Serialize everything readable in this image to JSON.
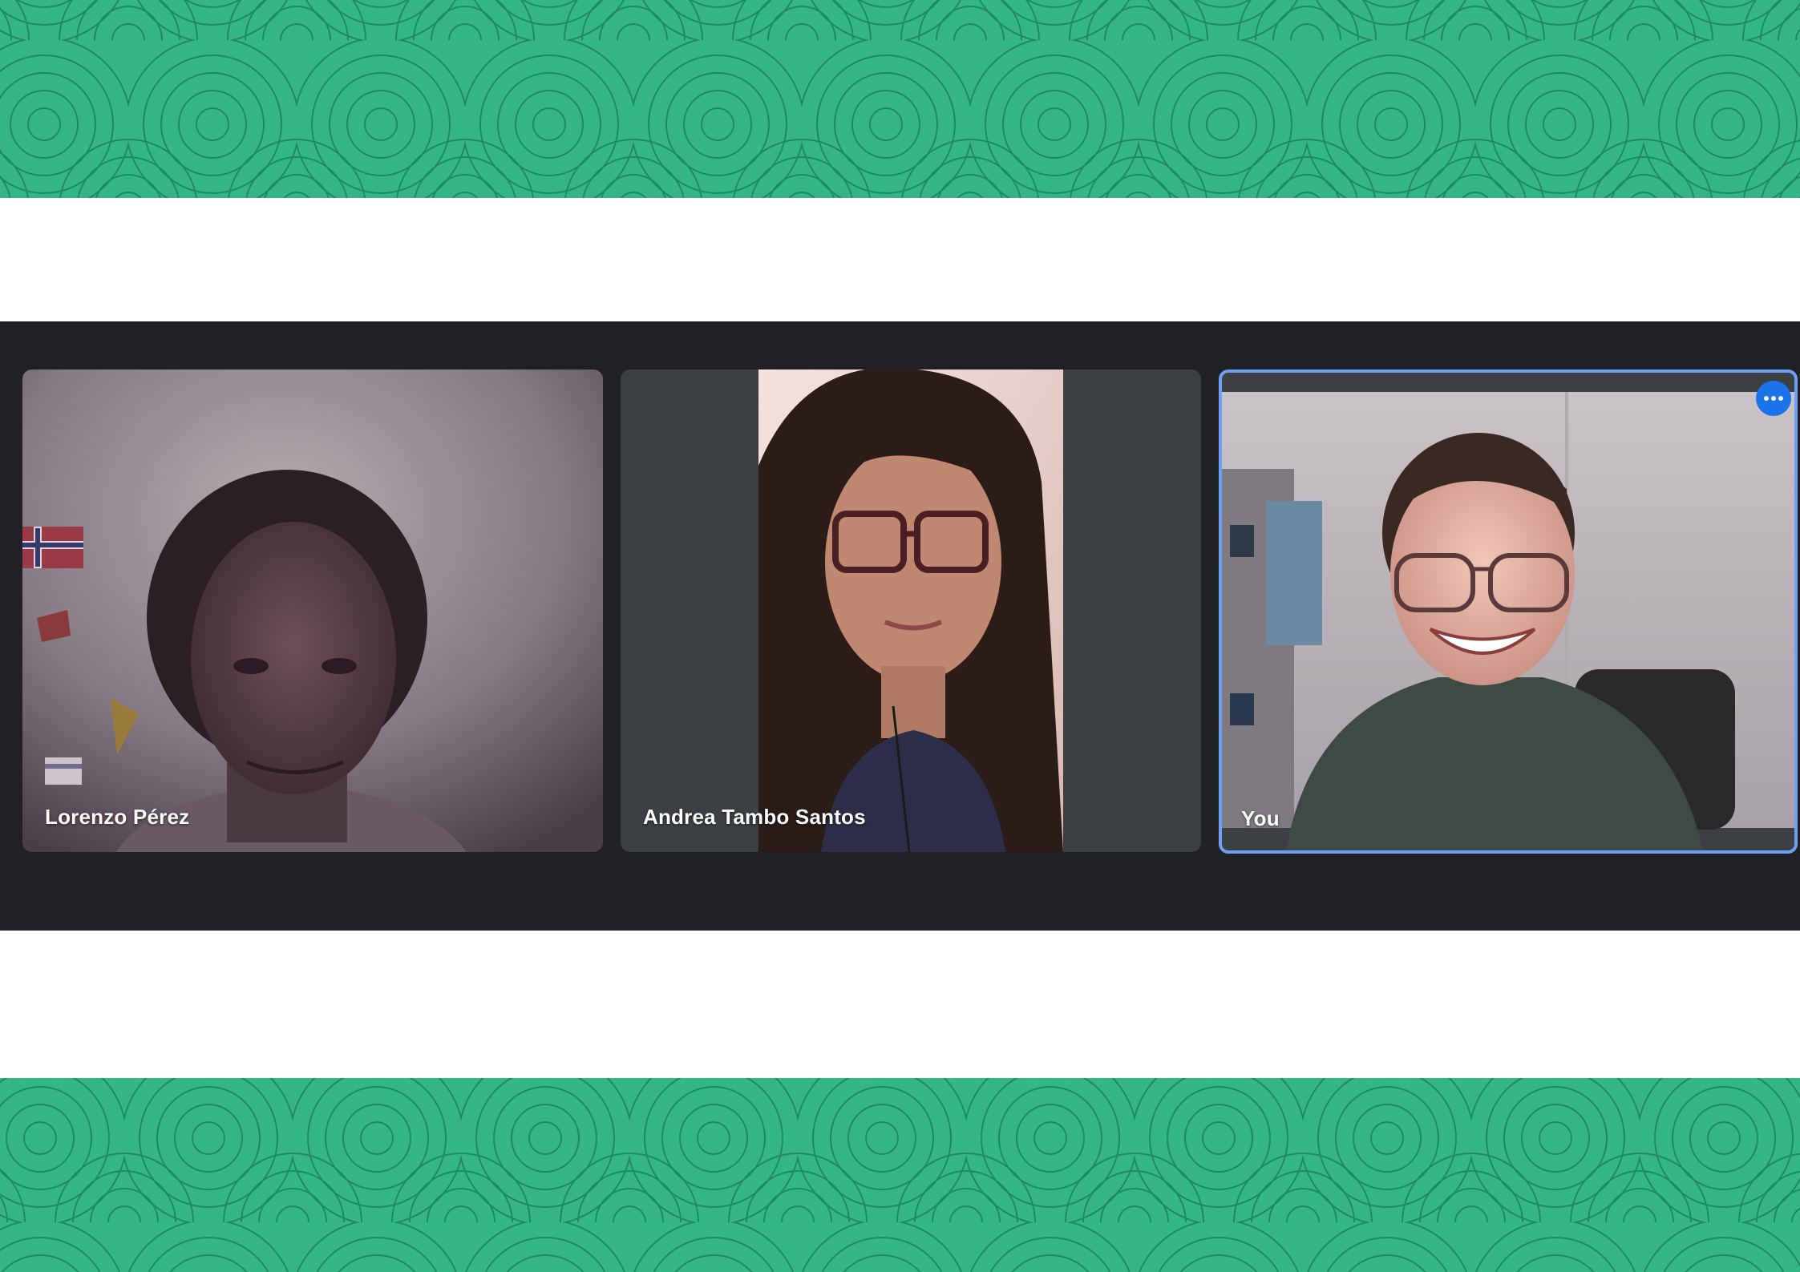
{
  "app": {
    "view": "video-call-grid"
  },
  "participants": [
    {
      "name": "Lorenzo Pérez"
    },
    {
      "name": "Andrea Tambo Santos"
    },
    {
      "name": "You",
      "self": true,
      "menu_icon": "more-options-icon"
    }
  ],
  "colors": {
    "band_bg": "#35b785",
    "band_line": "#1f8a5e",
    "strip_bg": "#202124",
    "tile_bg": "#3c4043",
    "self_border": "#6f9ff7",
    "menu_button": "#1a73e8"
  }
}
